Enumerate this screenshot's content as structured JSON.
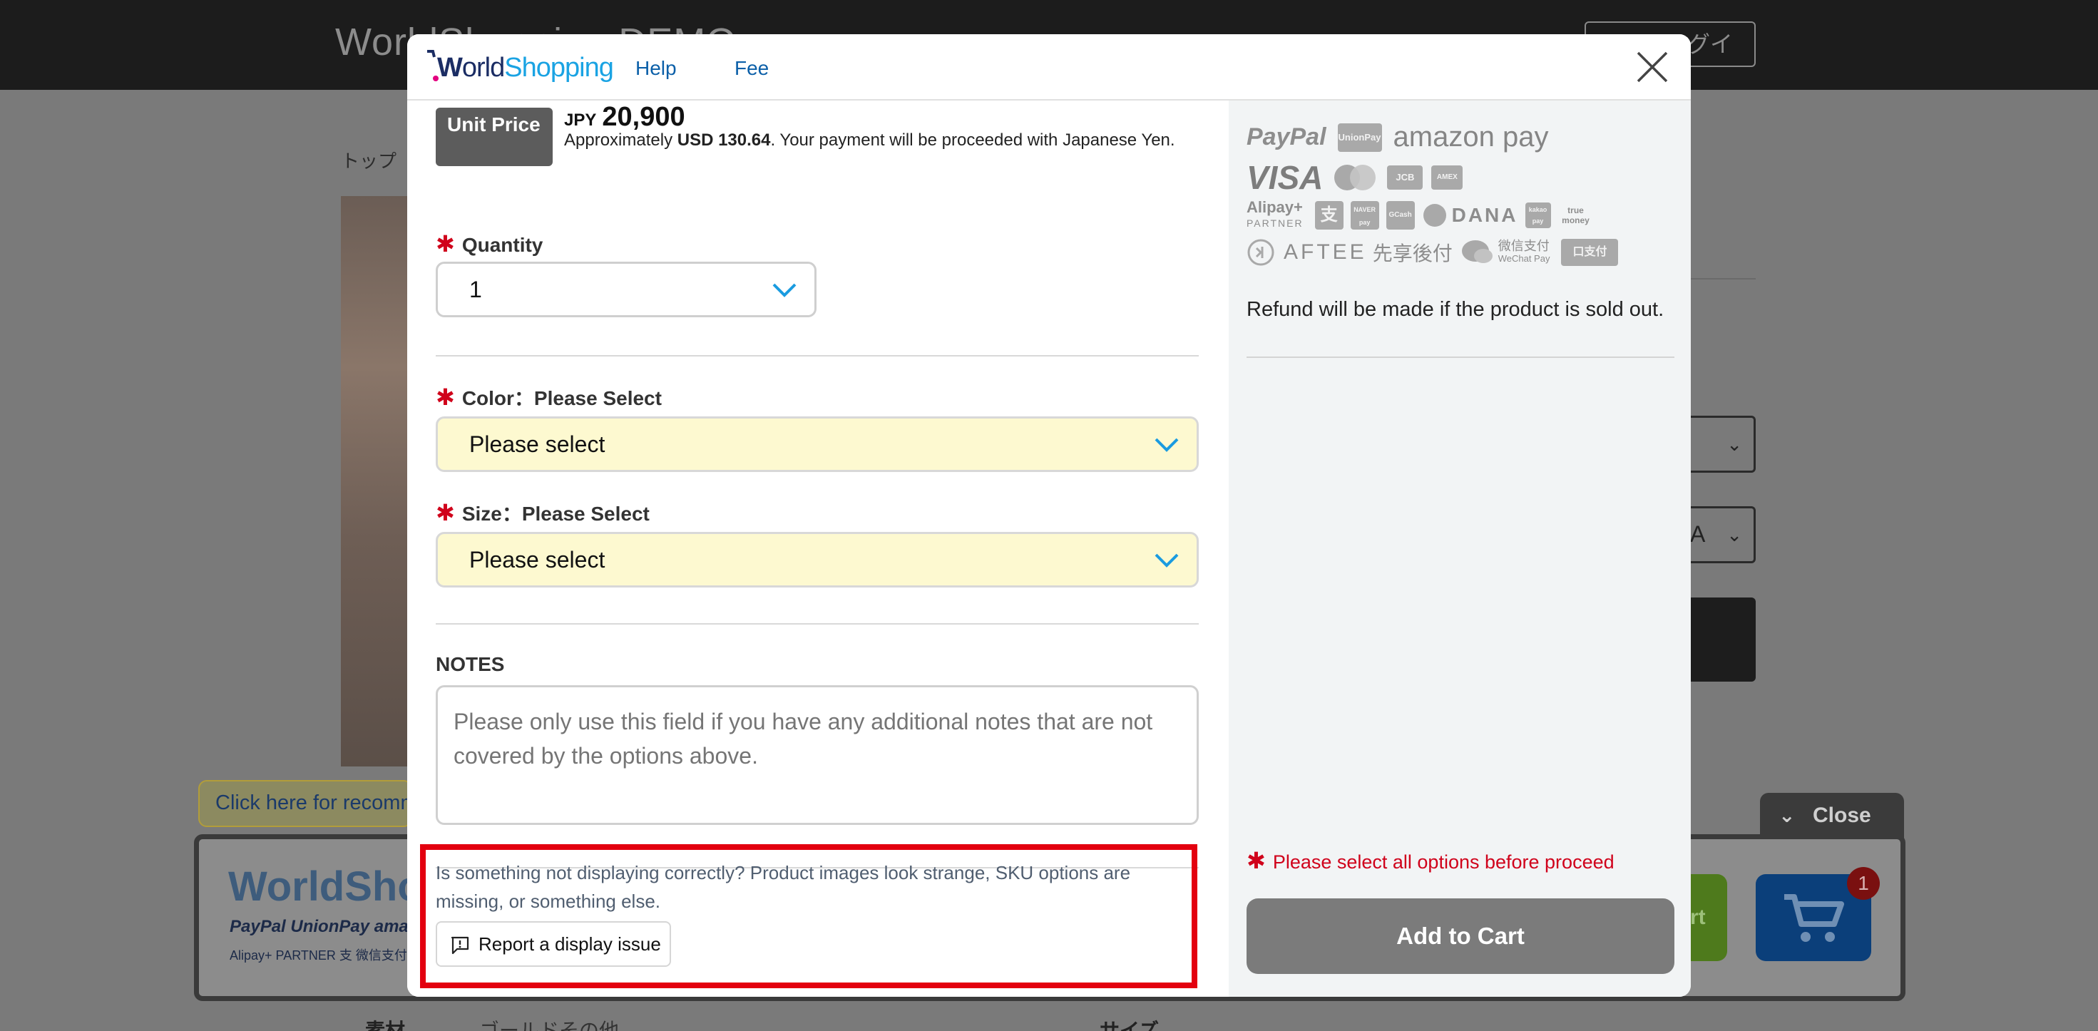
{
  "background": {
    "site_title": "WorldShopping DEMO",
    "login_label": "ログイン",
    "breadcrumb": "トップ",
    "select_letters": [
      "",
      "A"
    ],
    "specs": {
      "material_label": "素材",
      "material_value": "ゴールドその他",
      "size_label": "サイズ"
    },
    "widget": {
      "tooltip": "Click here for recommended items",
      "logo_text": "WorldShopping",
      "payments_line1": "PayPal  UnionPay  amazon pay",
      "payments_line2": "Alipay+ PARTNER  支  微信支付",
      "close_label": "Close",
      "green_btn_label": "rt",
      "cart_badge": "1"
    }
  },
  "modal": {
    "logo": {
      "w": "W",
      "orld": "orld",
      "shop": "Shopping"
    },
    "nav": {
      "help": "Help",
      "fee": "Fee"
    },
    "price": {
      "badge": "Unit Price",
      "currency": "JPY",
      "amount": "20,900",
      "note_prefix": "Approximately ",
      "usd": "USD 130.64",
      "note_suffix": ". Your payment will be proceeded with Japanese Yen."
    },
    "quantity": {
      "label": "Quantity",
      "value": "1"
    },
    "color": {
      "label": "Color：Please Select",
      "value": "Please select"
    },
    "size": {
      "label": "Size：Please Select",
      "value": "Please select"
    },
    "notes": {
      "label": "NOTES",
      "placeholder": "Please only use this field if you have any additional notes that are not covered by the options above."
    },
    "report": {
      "text": "Is something not displaying correctly? Product images look strange, SKU options are missing, or something else.",
      "button": "Report a display issue"
    },
    "right": {
      "payments": {
        "paypal": "PayPal",
        "unionpay": "UnionPay",
        "amazonpay": "amazon pay",
        "visa": "VISA",
        "jcb": "JCB",
        "amex": "AMEX",
        "alipay": "Alipay+",
        "partner": "PARTNER",
        "alipay_cn": "支",
        "naver": "NAVER pay",
        "gcash": "GCash",
        "dana": "DANA",
        "kakao": "kakao pay",
        "truemoney": "true money",
        "aftee": "AFTEE",
        "aftee_jp": "先享後付",
        "wechat_cn": "微信支付",
        "wechat_en": "WeChat Pay",
        "other": "口支付"
      },
      "refund_text": "Refund will be made if the product is sold out.",
      "warning": "Please select all options before proceed",
      "add_to_cart": "Add to Cart"
    }
  }
}
